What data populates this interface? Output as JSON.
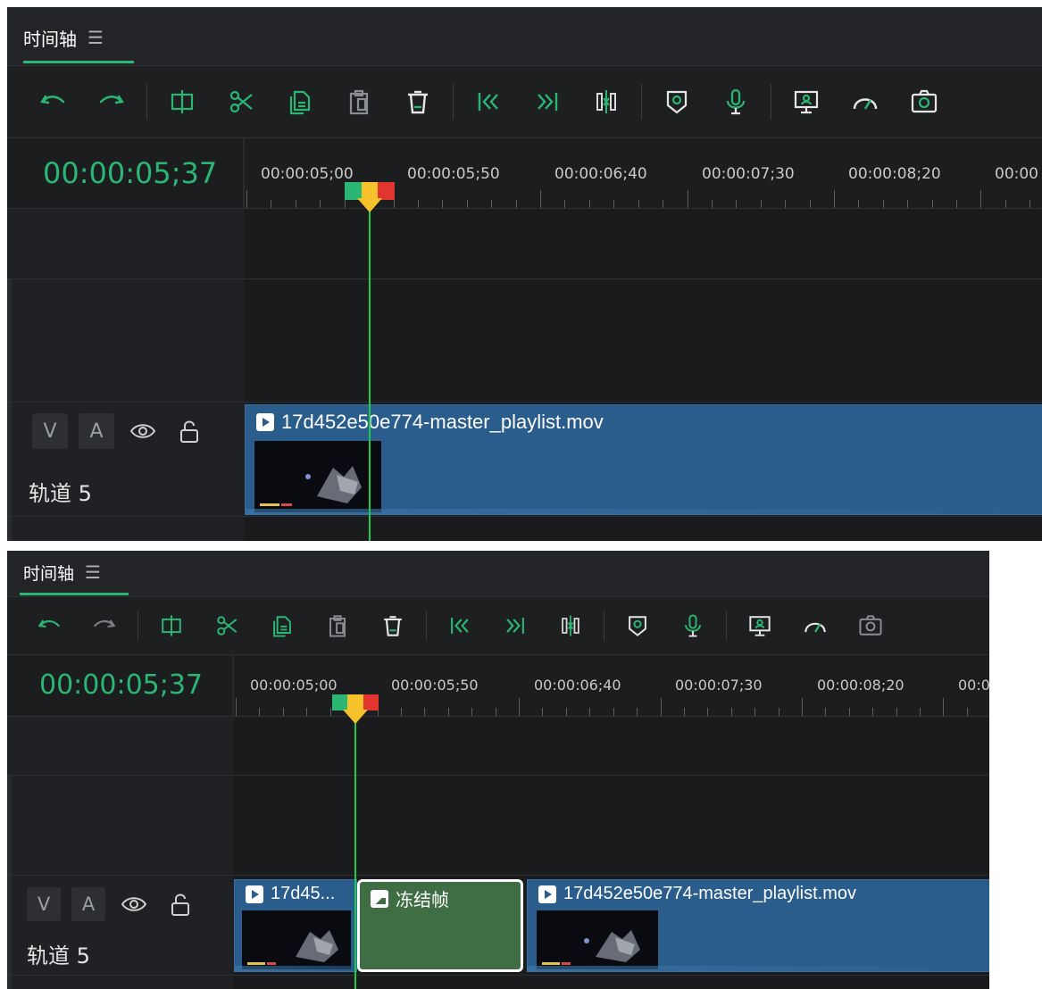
{
  "panels": [
    {
      "title": "时间轴",
      "timecode": "00:00:05;37",
      "ruler_labels": [
        "00:00:05;00",
        "00:00:05;50",
        "00:00:06;40",
        "00:00:07;30",
        "00:00:08;20",
        "00:00"
      ],
      "track": {
        "v_label": "V",
        "a_label": "A",
        "name": "轨道 5"
      },
      "clips": [
        {
          "label": "17d452e50e774-master_playlist.mov",
          "kind": "video"
        }
      ]
    },
    {
      "title": "时间轴",
      "timecode": "00:00:05;37",
      "ruler_labels": [
        "00:00:05;00",
        "00:00:05;50",
        "00:00:06;40",
        "00:00:07;30",
        "00:00:08;20",
        "00:0"
      ],
      "track": {
        "v_label": "V",
        "a_label": "A",
        "name": "轨道 5"
      },
      "clips": [
        {
          "label": "17d45...",
          "kind": "video"
        },
        {
          "label": "冻结帧",
          "kind": "freeze"
        },
        {
          "label": "17d452e50e774-master_playlist.mov",
          "kind": "video"
        }
      ]
    }
  ],
  "toolbar_icons": [
    "undo-icon",
    "redo-icon",
    "split-icon",
    "cut-icon",
    "copy-icon",
    "paste-icon",
    "delete-icon",
    "jump-start-icon",
    "jump-end-icon",
    "freeze-frame-icon",
    "marker-icon",
    "microphone-icon",
    "screen-record-icon",
    "speed-icon",
    "snapshot-icon"
  ],
  "colors": {
    "accent": "#2bb673",
    "clip_blue": "#2b5d8c",
    "freeze_green": "#3f6e45",
    "playhead_line": "#1fcc4a",
    "playhead_marker": [
      "#2bb673",
      "#f6c22b",
      "#e0362f"
    ]
  }
}
